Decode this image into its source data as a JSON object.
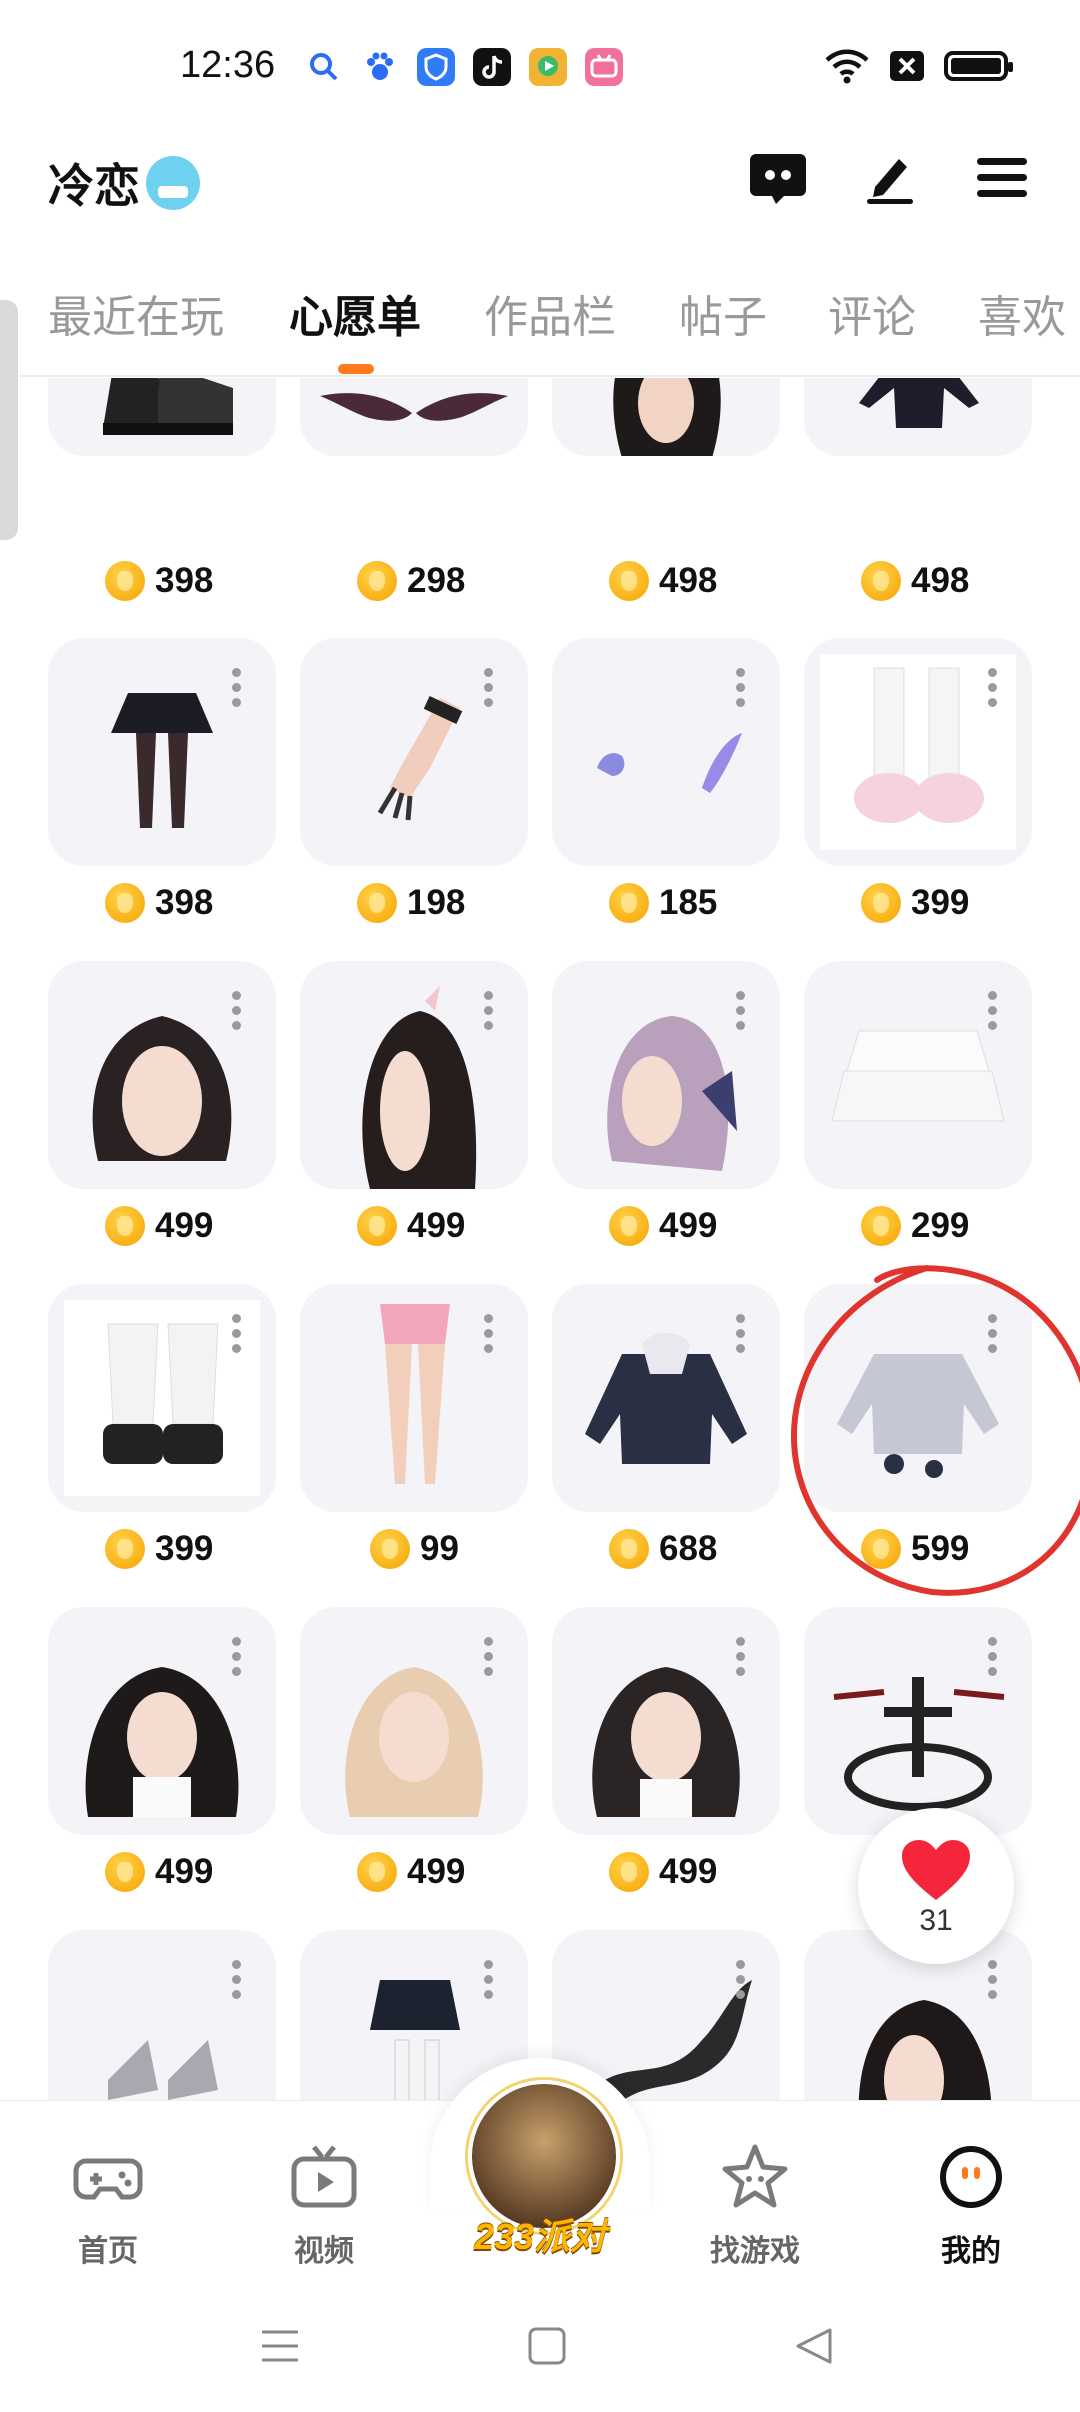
{
  "status_bar": {
    "time": "12:36"
  },
  "header": {
    "username": "冷恋"
  },
  "tabs": [
    {
      "label": "最近在玩",
      "active": false
    },
    {
      "label": "心愿单",
      "active": true
    },
    {
      "label": "作品栏",
      "active": false
    },
    {
      "label": "帖子",
      "active": false
    },
    {
      "label": "评论",
      "active": false
    },
    {
      "label": "喜欢",
      "active": false
    }
  ],
  "wishlist": {
    "rows": [
      [
        "398",
        "298",
        "498",
        "498"
      ],
      [
        "398",
        "198",
        "185",
        "399"
      ],
      [
        "499",
        "499",
        "499",
        "299"
      ],
      [
        "399",
        "99",
        "688",
        "599"
      ],
      [
        "499",
        "499",
        "499",
        ""
      ],
      [
        "",
        "",
        "",
        ""
      ]
    ]
  },
  "like_bubble": {
    "count": "31"
  },
  "bottom_nav": {
    "items": [
      {
        "label": "首页",
        "icon": "gamepad-icon"
      },
      {
        "label": "视频",
        "icon": "tv-icon"
      },
      {
        "label": "233派对",
        "icon": "party-avatar"
      },
      {
        "label": "找游戏",
        "icon": "star-icon"
      },
      {
        "label": "我的",
        "icon": "smile-face-icon"
      }
    ]
  },
  "colors": {
    "accent": "#ff7a1a",
    "annotation": "#e0342f",
    "coin": "#f6a300"
  }
}
